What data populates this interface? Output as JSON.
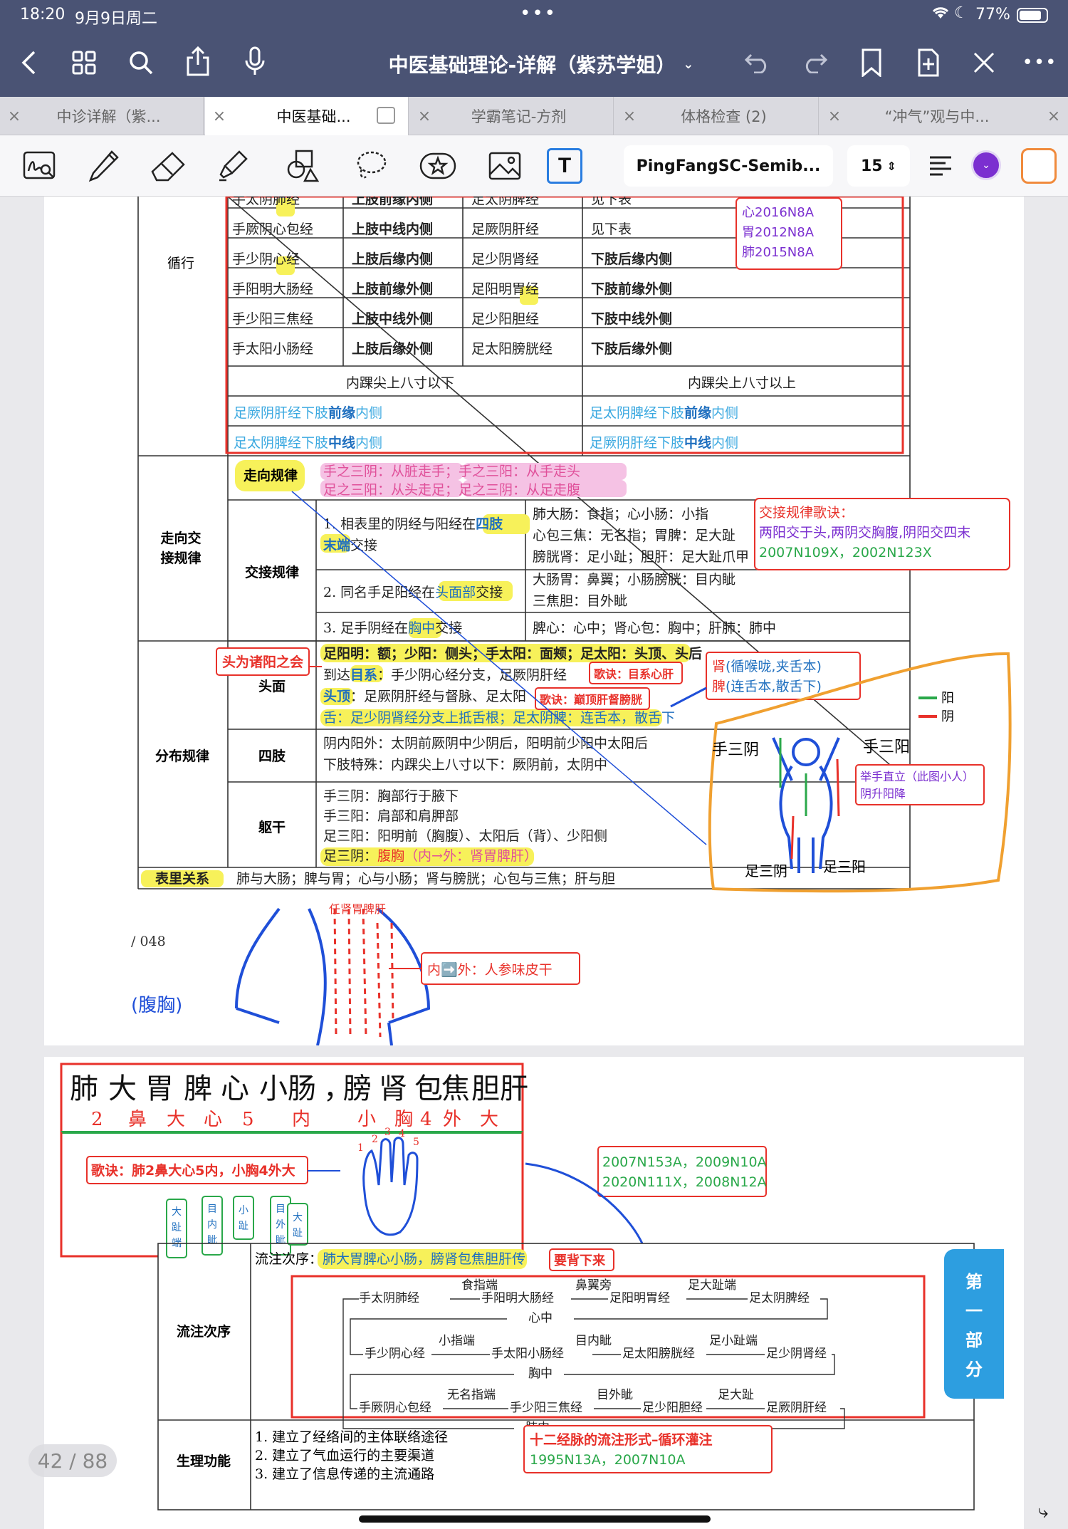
{
  "status": {
    "time": "18:20",
    "date": "9月9日周二",
    "battery": "77%"
  },
  "title": "中医基础理论-详解（紫苏学姐）",
  "tabs": [
    {
      "label": "中诊详解（紫..."
    },
    {
      "label": "中医基础..."
    },
    {
      "label": "学霸笔记-方剂"
    },
    {
      "label": "体格检查 (2)"
    },
    {
      "label": "“冲气”观与中..."
    }
  ],
  "toolbar": {
    "font": "PingFangSC-Semib...",
    "size": "15",
    "accent_color": "#7b2fd0",
    "highlight_color": "#f08a3c"
  },
  "p1": {
    "xunxing": {
      "label": "循行",
      "rows": [
        [
          "手太阴",
          "肺",
          "经",
          "上肢前缘内侧",
          "足太阴脾经",
          "见下表"
        ],
        [
          "手厥阴心包经",
          "",
          "",
          "上肢中线内侧",
          "足厥阴肝经",
          "见下表"
        ],
        [
          "手少阴",
          "心",
          "经",
          "上肢后缘内侧",
          "足少阴肾经",
          "下肢后缘内侧"
        ],
        [
          "手阳明大肠经",
          "",
          "",
          "上肢前缘外侧",
          "足阳明",
          "胃",
          "经|下肢前缘外侧"
        ],
        [
          "手少阳三焦经",
          "",
          "",
          "上肢中线外侧",
          "足少阳胆经",
          "下肢中线外侧"
        ],
        [
          "手太阳小肠经",
          "",
          "",
          "上肢后缘外侧",
          "足太阳膀胱经",
          "下肢后缘外侧"
        ]
      ],
      "sub_left": "内踝尖上八寸以下",
      "sub_right": "内踝尖上八寸以上",
      "blue1a": "足厥阴肝经下肢",
      "blue1b": "前缘",
      "blue1c": "内侧",
      "blue2a": "足太阴脾经下肢",
      "blue2b": "前缘",
      "blue2c": "内侧",
      "blue3a": "足太阴脾经下肢",
      "blue3b": "中线",
      "blue3c": "内侧",
      "blue4a": "足厥阴肝经下肢",
      "blue4b": "中线",
      "blue4c": "内侧",
      "note": [
        "心2016N8A",
        "胃2012N8A",
        "肺2015N8A"
      ]
    },
    "zoux": {
      "label": "走向交接规律",
      "zoux_label": "走向规律",
      "zoux_line1": "手之三阴：从脏走手；手之三阳：从手走头",
      "zoux_line2": "足之三阳：从头走足；足之三阴：从足走腹",
      "jiaojie_label": "交接规律",
      "r1a": "1. 相表里的阴经与阳经在",
      "r1b": "四肢末端",
      "r1c": "交接",
      "r1right": [
        "肺大肠：食指；心小肠：小指",
        "心包三焦：无名指；胃脾：足大趾",
        "膀胱肾：足小趾；胆肝：足大趾爪甲"
      ],
      "r2a": "2. 同名手足阳经在",
      "r2b": "头面部",
      "r2c": "交接",
      "r2right": [
        "大肠胃：鼻翼；小肠膀胱：目内眦",
        "三焦胆：目外眦"
      ],
      "r3a": "3. 足手阴经在",
      "r3b": "胸中",
      "r3c": "交接",
      "r3right": "脾心：心中；肾心包：胸中；肝肺：肺中",
      "note_title": "交接规律歌诀：",
      "note_line": "两阳交于头,两阴交胸腹,阴阳交四末",
      "note_code": "2007N109X，2002N123X"
    },
    "fenbu": {
      "label": "分布规律",
      "tou_label": "头面",
      "tou1": "足阳明：额；少阳：侧头；手太阳：面颊；足太阳：头顶、头后",
      "tou2a": "到达",
      "tou2b": "目系",
      "tou2c": "：手少阴心经分支，足厥阴肝经",
      "tou3a": "头顶",
      "tou3b": "：足厥阴肝经与督脉、足太阳",
      "tou4": "舌：足少阴肾经分支上抵舌根；足太阴脾：连舌本，散舌下",
      "sizhi_label": "四肢",
      "sizhi1": "阴内阳外：太阴前厥阴中少阴后，阳明前少阳中太阳后",
      "sizhi2": "下肢特殊：内踝尖上八寸以下：厥阴前，太阴中",
      "quga_label": "躯干",
      "quga1": "手三阴：胸部行于腋下",
      "quga2": "手三阳：肩部和肩胛部",
      "quga3": "足三阳：阳明前（胸腹）、太阳后（背）、少阳侧",
      "quga4a": "足三阴：",
      "quga4b": "腹胸",
      "quga4c": "（内→外：肾胃脾肝）",
      "biaoli_label": "表里关系",
      "biaoli": "肺与大肠；脾与胃；心与小肠；肾与膀胱；心包与三焦；肝与胆",
      "toulabel": "头为诸阳之会",
      "gejue1": "歌诀：目系心肝",
      "gejue2": "歌诀：巅顶肝督膀胱",
      "shen": "肾(循喉咙,夹舌本)",
      "pi": "脾(连舌本,散舌下)",
      "legend_yang": "阳",
      "legend_yin": "阴",
      "hand3yin": "手三阴",
      "hand3yang": "手三阳",
      "foot3yin": "足三阴",
      "foot3yang": "足三阳",
      "jushou": "举手直立（此图小人）",
      "yinsheng": "阴升阳降"
    },
    "pagenum": "/ 048",
    "neiwai": "内➡️外：人参味皮干",
    "fuxiong": "(腹胸)",
    "scribble_top": "任肾胃脾肝"
  },
  "p2": {
    "top_row1": [
      "肺",
      "大",
      "胃",
      "脾",
      "心",
      "小肠",
      "，",
      "膀",
      "肾",
      "包",
      "焦",
      "胆",
      "肝"
    ],
    "top_row2": [
      "2",
      "鼻",
      "大",
      "心",
      "5",
      "内",
      "小",
      "胸",
      "4",
      "外",
      "大"
    ],
    "gejue": "歌诀：肺2鼻大心5内，小胸4外大",
    "boxes": [
      "大趾端",
      "目内眦",
      "小趾",
      "目外眦",
      "大趾"
    ],
    "codes1": "2007N153A，2009N10A",
    "codes2": "2020N111X，2008N12A",
    "liuzhu_label": "流注次序",
    "liuzhu_text_a": "流注次序：",
    "liuzhu_text_b": "肺大胃脾心小肠，膀肾包焦胆肝传",
    "beixia": "要背下来",
    "chain1": [
      "手太阴肺经",
      "食指端",
      "手阳明大肠经",
      "鼻翼旁",
      "足阳明胃经",
      "足大趾端",
      "足太阴脾经"
    ],
    "mid1": "心中",
    "chain2": [
      "手少阴心经",
      "小指端",
      "手太阳小肠经",
      "目内眦",
      "足太阳膀胱经",
      "足小趾端",
      "足少阴肾经"
    ],
    "mid2": "胸中",
    "chain3": [
      "手厥阴心包经",
      "无名指端",
      "手少阳三焦经",
      "目外眦",
      "足少阳胆经",
      "足大趾",
      "足厥阴肝经"
    ],
    "mid3": "肺中",
    "shengli_label": "生理功能",
    "shengli": [
      "1. 建立了经络间的主体联络途径",
      "2. 建立了气血运行的主要渠道",
      "3. 建立了信息传递的主流通路"
    ],
    "xunhuan_title": "十二经脉的流注形式–循环灌注",
    "xunhuan_code": "1995N13A，2007N10A",
    "side_tab": [
      "第",
      "一",
      "部",
      "分"
    ],
    "page_indicator": "42 / 88"
  }
}
